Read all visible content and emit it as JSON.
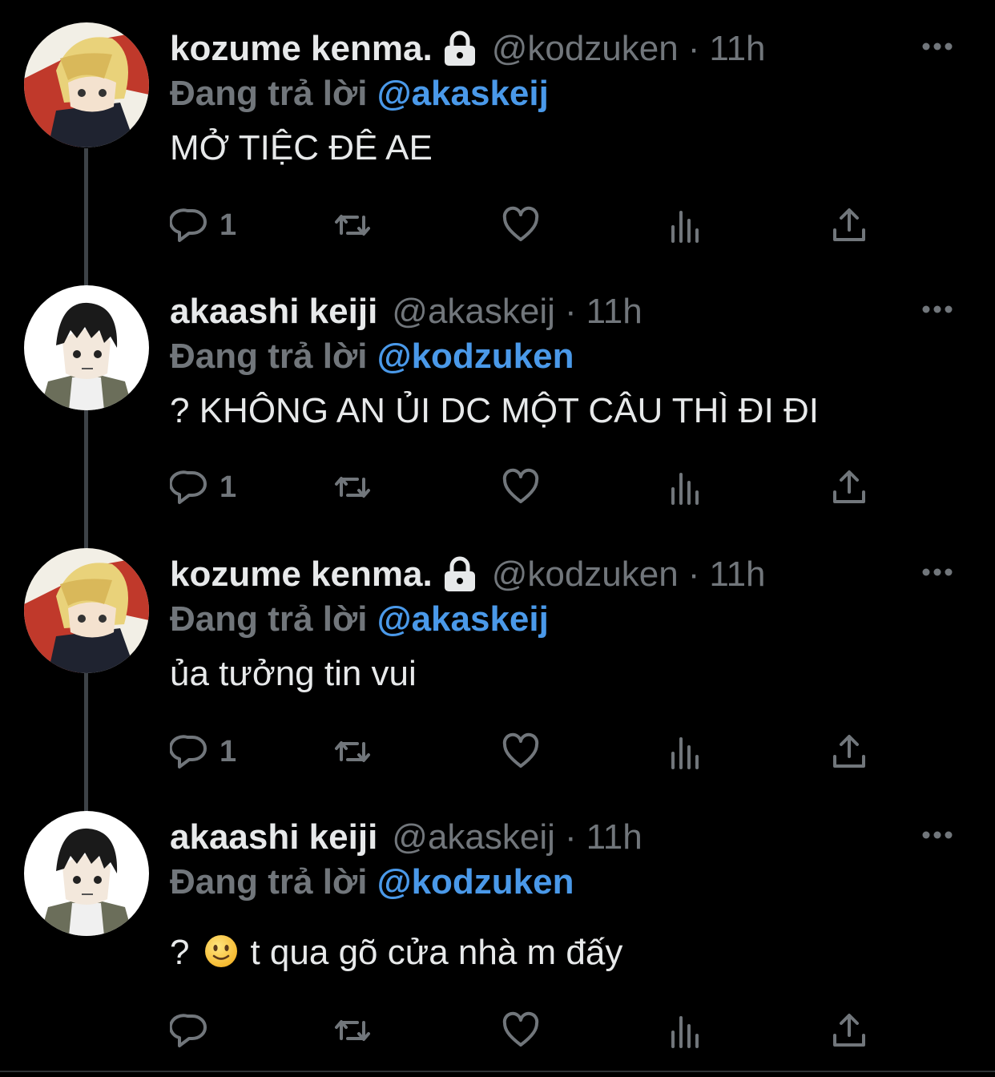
{
  "colors": {
    "background": "#000000",
    "text_primary": "#e7e9ea",
    "text_secondary": "#71767b",
    "link_blue": "#4a99e9",
    "thread_line": "#3d4247"
  },
  "icons": {
    "lock": "lock-icon",
    "more": "more-dots-icon",
    "reply": "reply-bubble-icon",
    "retweet": "retweet-icon",
    "like": "heart-icon",
    "views": "views-bar-chart-icon",
    "share": "share-upload-icon",
    "emoji": "slightly-smiling-face-emoji"
  },
  "tweets": [
    {
      "display_name": "kozume kenma.",
      "protected": true,
      "handle": "@kodzuken",
      "separator": "·",
      "time": "11h",
      "reply_prefix": "Đang trả lời",
      "reply_to": "@akaskeij",
      "text": "MỞ TIỆC ĐÊ AE",
      "reply_count": "1",
      "avatar": "kenma"
    },
    {
      "display_name": "akaashi keiji",
      "protected": false,
      "handle": "@akaskeij",
      "separator": "·",
      "time": "11h",
      "reply_prefix": "Đang trả lời",
      "reply_to": "@kodzuken",
      "text": "? KHÔNG AN ỦI DC MỘT CÂU THÌ ĐI ĐI",
      "reply_count": "1",
      "avatar": "akaashi"
    },
    {
      "display_name": "kozume kenma.",
      "protected": true,
      "handle": "@kodzuken",
      "separator": "·",
      "time": "11h",
      "reply_prefix": "Đang trả lời",
      "reply_to": "@akaskeij",
      "text": "ủa tưởng tin vui",
      "reply_count": "1",
      "avatar": "kenma"
    },
    {
      "display_name": "akaashi keiji",
      "protected": false,
      "handle": "@akaskeij",
      "separator": "·",
      "time": "11h",
      "reply_prefix": "Đang trả lời",
      "reply_to": "@kodzuken",
      "text_before_emoji": "?",
      "text_after_emoji": "t qua gõ cửa nhà m đấy",
      "reply_count": "",
      "avatar": "akaashi"
    }
  ]
}
